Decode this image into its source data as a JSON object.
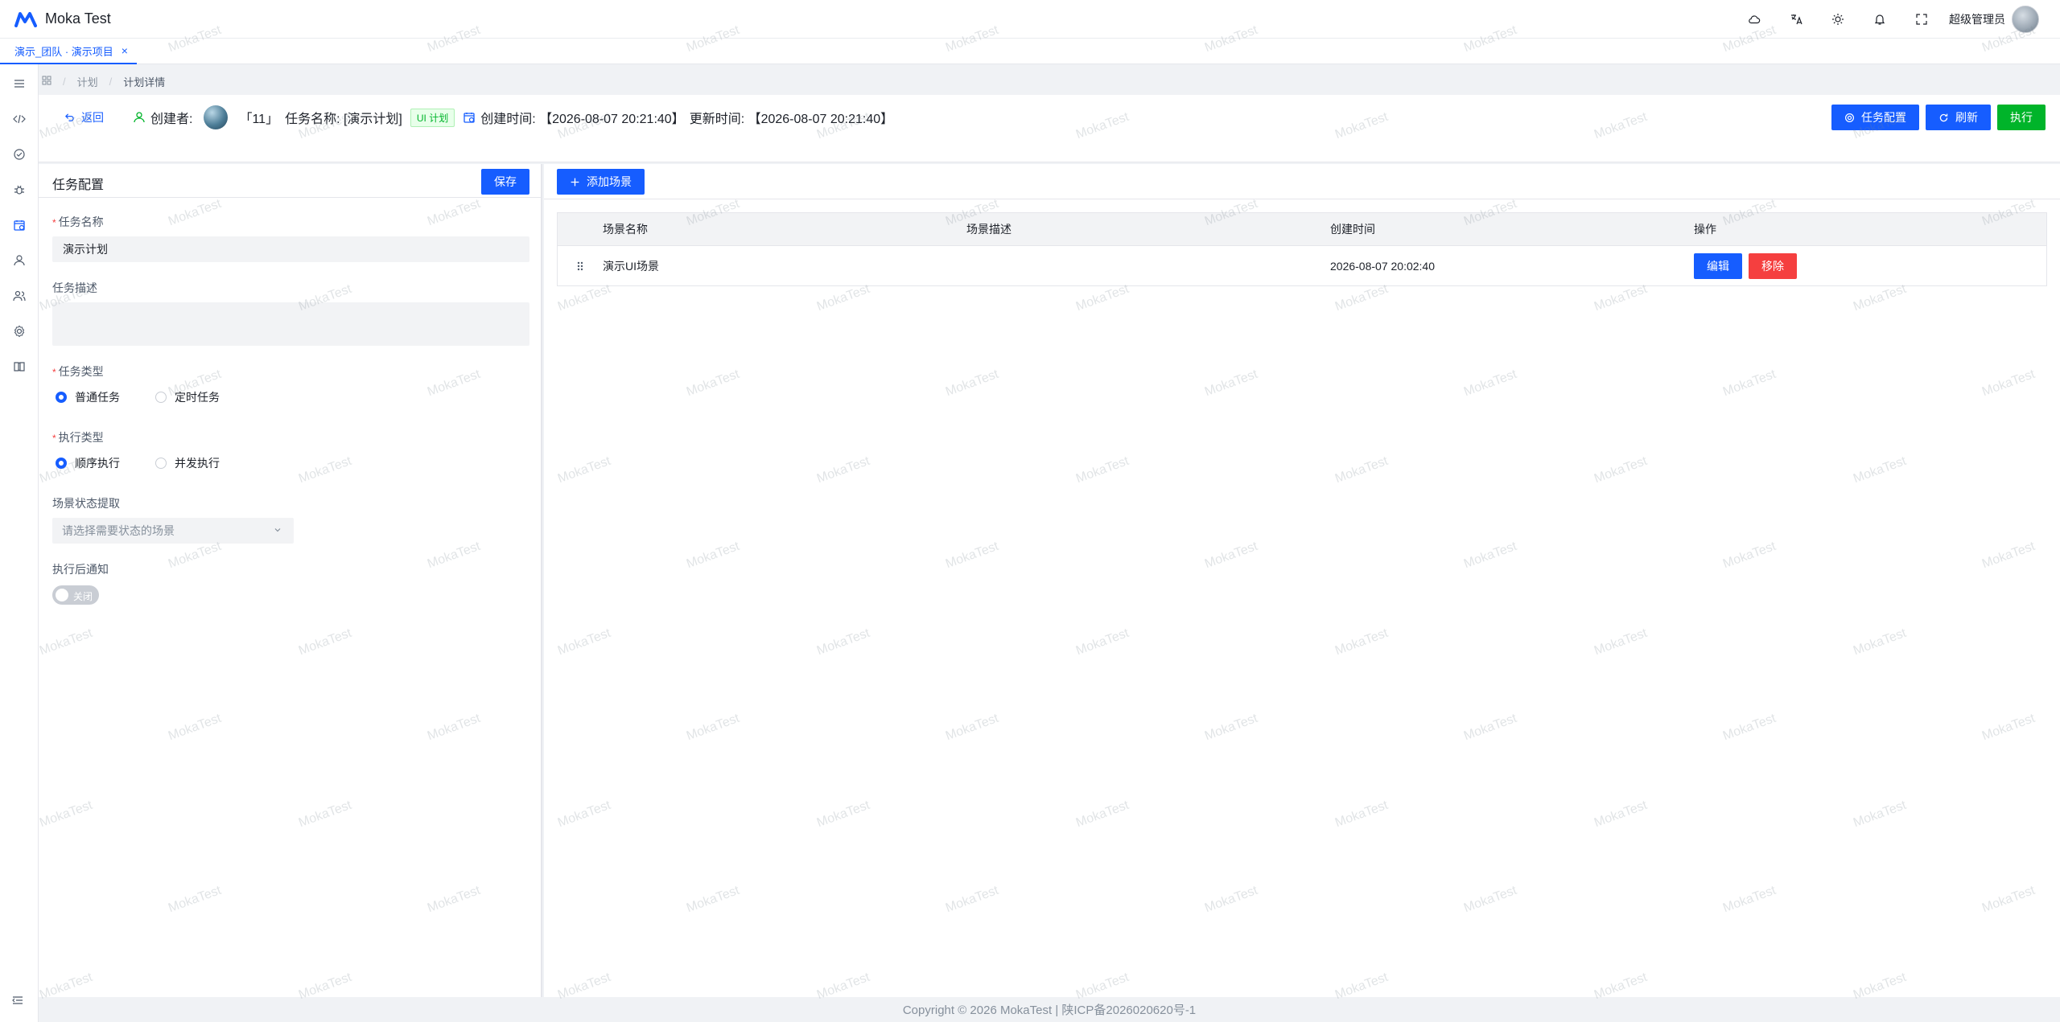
{
  "app": {
    "title": "Moka Test"
  },
  "header": {
    "username": "超级管理员"
  },
  "tabs": [
    {
      "label": "演示_团队 · 演示项目"
    }
  ],
  "breadcrumb": {
    "items": [
      "计划",
      "计划详情"
    ]
  },
  "info": {
    "back_label": "返回",
    "creator_label": "创建者:",
    "task_id": "「11」",
    "task_name": "任务名称: [演示计划]",
    "task_type_tag": "UI 计划",
    "created": "创建时间: 【2026-08-07 20:21:40】",
    "updated": "更新时间: 【2026-08-07 20:21:40】",
    "buttons": {
      "config": "任务配置",
      "refresh": "刷新",
      "execute": "执行"
    }
  },
  "config": {
    "title": "任务配置",
    "save_label": "保存",
    "name_label": "任务名称",
    "name_value": "演示计划",
    "desc_label": "任务描述",
    "desc_value": "",
    "type_label": "任务类型",
    "type_options": [
      "普通任务",
      "定时任务"
    ],
    "type_selected": "普通任务",
    "exec_label": "执行类型",
    "exec_options": [
      "顺序执行",
      "并发执行"
    ],
    "exec_selected": "顺序执行",
    "state_label": "场景状态提取",
    "state_placeholder": "请选择需要状态的场景",
    "notify_label": "执行后通知",
    "notify_switch": "关闭"
  },
  "scenes": {
    "add_label": "添加场景",
    "columns": [
      "场景名称",
      "场景描述",
      "创建时间",
      "操作"
    ],
    "rows": [
      {
        "name": "演示UI场景",
        "desc": "",
        "created": "2026-08-07 20:02:40",
        "edit": "编辑",
        "remove": "移除"
      }
    ]
  },
  "footer": {
    "text": "Copyright © 2026 MokaTest | 陕ICP备2026020620号-1"
  },
  "watermark": "MokaTest",
  "colors": {
    "primary": "#165dff",
    "success": "#00b42a",
    "danger": "#f53f3f"
  }
}
